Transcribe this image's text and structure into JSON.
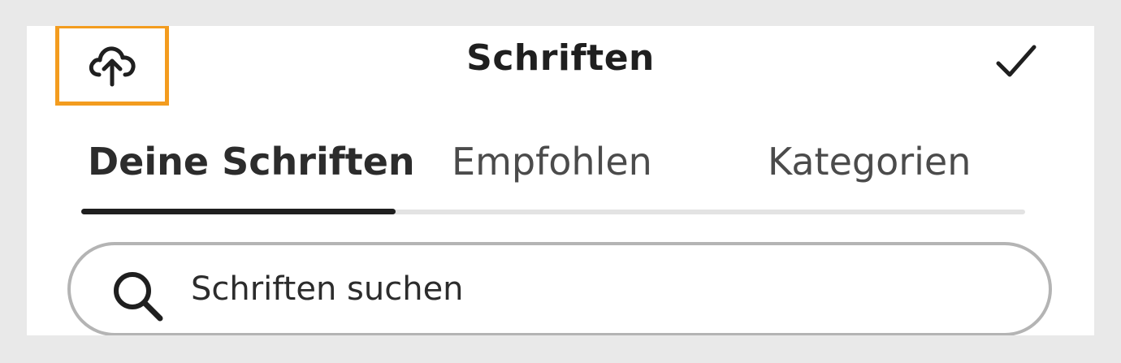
{
  "header": {
    "title": "Schriften",
    "upload_icon": "cloud-upload-icon",
    "done_icon": "checkmark-icon"
  },
  "tabs": [
    {
      "label": "Deine Schriften",
      "active": true
    },
    {
      "label": "Empfohlen",
      "active": false
    },
    {
      "label": "Kategorien",
      "active": false
    }
  ],
  "search": {
    "placeholder": "Schriften suchen",
    "value": "",
    "icon": "search-icon"
  },
  "colors": {
    "highlight": "#f39c1f",
    "text": "#2c2c2c",
    "tab_indicator": "#1f1f1f",
    "tab_track": "#e3e3e3",
    "search_border": "#b4b4b4"
  }
}
